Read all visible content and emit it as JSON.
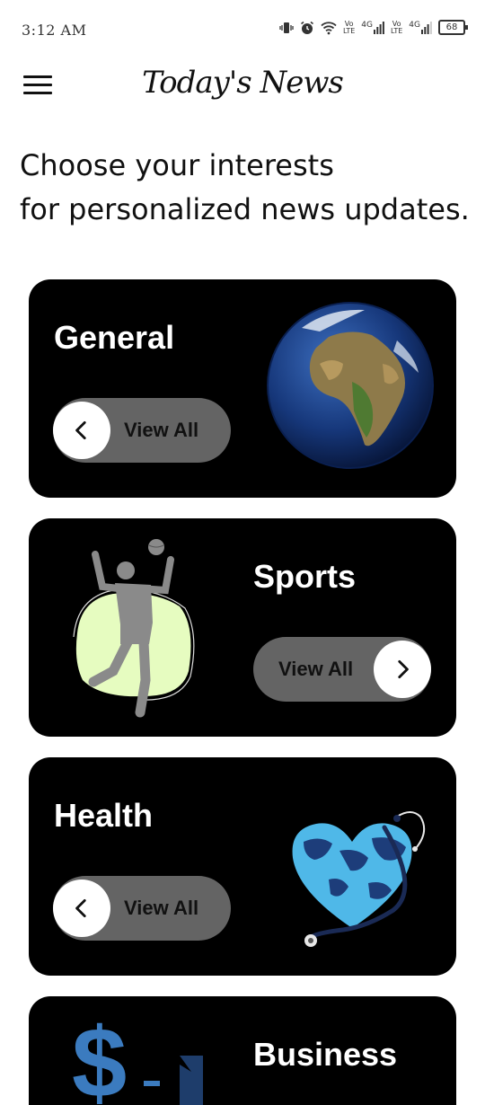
{
  "status_bar": {
    "time": "3:12 AM",
    "net1": "Vo\nLTE",
    "net2": "4G",
    "net3": "Vo\nLTE",
    "net4": "4G",
    "battery": "68"
  },
  "app": {
    "title": "Today's News",
    "menu_icon": "hamburger-menu-icon"
  },
  "headline": {
    "line1": "Choose your interests",
    "line2": "for personalized news updates."
  },
  "categories": [
    {
      "title": "General",
      "button": "View All",
      "arrow": "chevron-left-icon",
      "image": "globe-illustration"
    },
    {
      "title": "Sports",
      "button": "View All",
      "arrow": "chevron-right-icon",
      "image": "volleyball-player-illustration"
    },
    {
      "title": "Health",
      "button": "View All",
      "arrow": "chevron-left-icon",
      "image": "heart-globe-stethoscope-illustration"
    },
    {
      "title": "Business",
      "image": "dollar-chart-illustration"
    }
  ],
  "colors": {
    "card_bg": "#000000",
    "pill_bg": "#646464",
    "sports_accent": "#e6fcc0",
    "health_blue": "#4fb8e8",
    "business_blue": "#3b7bbf"
  }
}
